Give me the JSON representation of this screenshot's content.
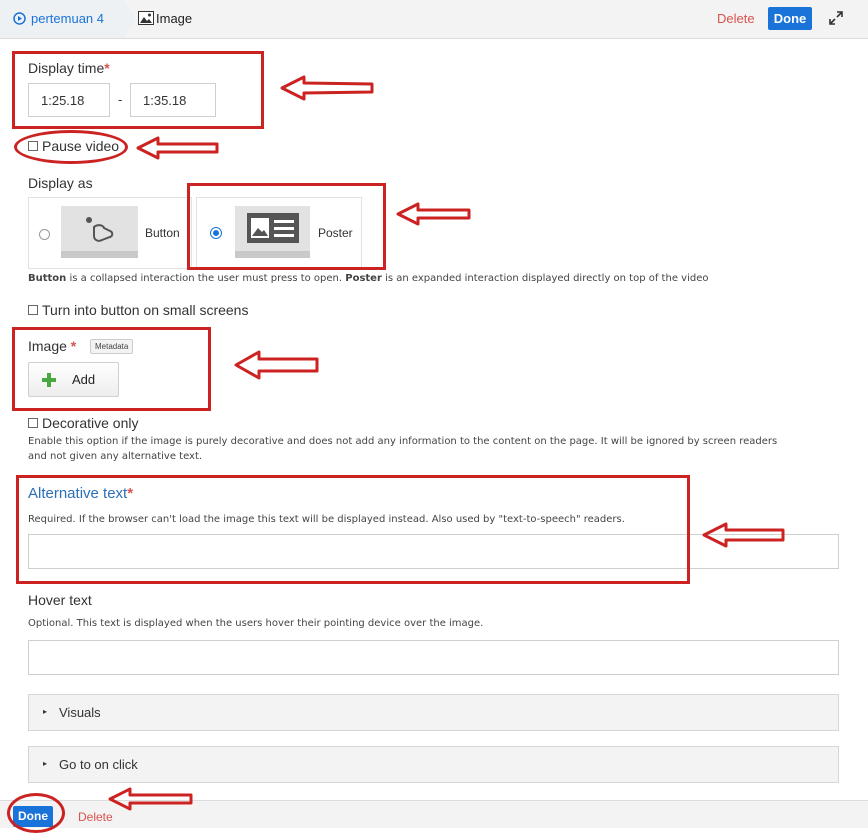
{
  "breadcrumb": {
    "video": "pertemuan 4",
    "current": "Image"
  },
  "toolbar": {
    "delete": "Delete",
    "done": "Done"
  },
  "display_time": {
    "label": "Display time",
    "start": "1:25.18",
    "separator": "-",
    "end": "1:35.18"
  },
  "pause_video": {
    "label": "Pause video",
    "checked": false
  },
  "display_as": {
    "label": "Display as",
    "options": [
      {
        "label": "Button",
        "selected": false
      },
      {
        "label": "Poster",
        "selected": true
      }
    ],
    "help_b1": "Button",
    "help_t1": " is a collapsed interaction the user must press to open. ",
    "help_b2": "Poster",
    "help_t2": " is an expanded interaction displayed directly on top of the video"
  },
  "small_screens": {
    "label": "Turn into button on small screens",
    "checked": false
  },
  "image": {
    "label": "Image",
    "metadata": "Metadata",
    "add": "Add"
  },
  "decorative": {
    "label": "Decorative only",
    "help_line1": "Enable this option if the image is purely decorative and does not add any information to the content on the page. It will be ignored by screen readers",
    "help_line2": "and not given any alternative text."
  },
  "alt_text": {
    "label": "Alternative text",
    "help": "Required. If the browser can't load the image this text will be displayed instead. Also used by \"text-to-speech\" readers.",
    "value": ""
  },
  "hover_text": {
    "label": "Hover text",
    "help": "Optional. This text is displayed when the users hover their pointing device over the image.",
    "value": ""
  },
  "groups": {
    "visuals": "Visuals",
    "goto": "Go to on click"
  },
  "footer": {
    "done": "Done",
    "delete": "Delete"
  },
  "colors": {
    "accent": "#1a73d9",
    "required": "#d9534f",
    "annotation": "#cc2222"
  },
  "icons": [
    "play-circle-icon",
    "image-icon",
    "expand-icon",
    "plus-icon",
    "arrow-left-icon"
  ]
}
